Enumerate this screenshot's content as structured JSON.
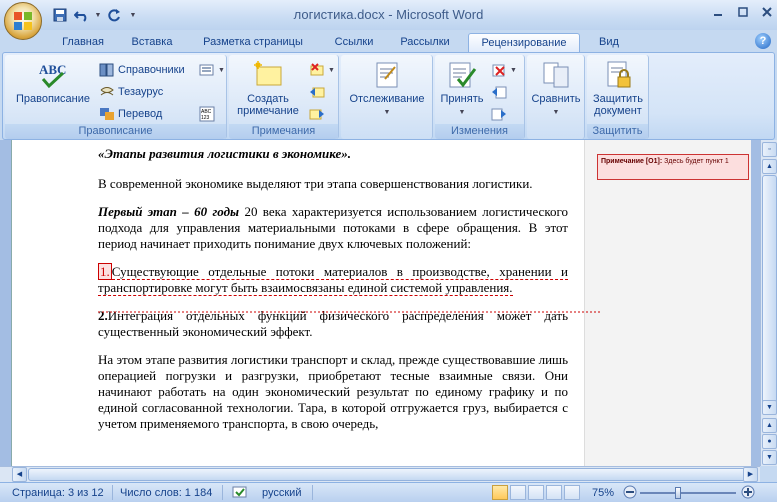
{
  "window": {
    "title": "логистика.docx - Microsoft Word"
  },
  "tabs": [
    {
      "label": "Главная"
    },
    {
      "label": "Вставка"
    },
    {
      "label": "Разметка страницы"
    },
    {
      "label": "Ссылки"
    },
    {
      "label": "Рассылки"
    },
    {
      "label": "Рецензирование",
      "active": true
    },
    {
      "label": "Вид"
    }
  ],
  "ribbon": {
    "proofing": {
      "label": "Правописание",
      "spelling": "Правописание",
      "research": "Справочники",
      "thesaurus": "Тезаурус",
      "translate": "Перевод"
    },
    "comments": {
      "label": "Примечания",
      "new_comment_line1": "Создать",
      "new_comment_line2": "примечание"
    },
    "tracking": {
      "label": "Отслеживание"
    },
    "changes": {
      "label": "Изменения",
      "accept": "Принять"
    },
    "compare": {
      "label": "Сравнить"
    },
    "protect": {
      "label": "Защитить",
      "protect_line1": "Защитить",
      "protect_line2": "документ"
    }
  },
  "document": {
    "heading": "«Этапы развития логистики в экономике».",
    "p1": "В современной экономике выделяют три этапа совершенствования логистики.",
    "p2_bold": "Первый этап – 60 годы",
    "p2_rest": " 20 века характеризуется использованием логистического подхода для управления материальными потоками в сфере обращения. В этот период начинает приходить понимание двух ключевых положений:",
    "p3_mark": "1.",
    "p3_rest": "Существующие отдельные потоки материалов в производстве, хранении и транспортировке могут быть взаимосвязаны единой системой управления.",
    "p4_num": "2.",
    "p4_rest": "Интеграция отдельных функций физического распределения может дать существенный экономический эффект.",
    "p5": "На этом этапе развития логистики транспорт и склад, прежде существовавшие лишь операцией погрузки и разгрузки, приобретают тесные взаимные связи. Они начинают работать на один экономический результат по единому графику и по единой согласованной технологии. Тара, в которой отгружается груз, выбирается с учетом применяемого транспорта, в свою очередь,"
  },
  "comment": {
    "label": "Примечание [О1]:",
    "text": "Здесь будет пункт 1"
  },
  "status": {
    "page": "Страница: 3 из 12",
    "words": "Число слов: 1 184",
    "language": "русский",
    "zoom": "75%"
  },
  "colors": {
    "ribbon_bg": "#d4e4f7",
    "text": "#15428b",
    "comment_border": "#cc3333",
    "comment_bg": "#fcdede"
  }
}
